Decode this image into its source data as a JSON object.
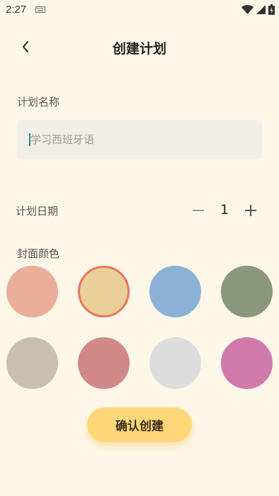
{
  "status_bar": {
    "time": "2:27",
    "icons": [
      "keyboard-icon",
      "wifi-icon",
      "signal-icon",
      "battery-icon"
    ]
  },
  "header": {
    "back_icon": "chevron-left-icon",
    "title": "创建计划"
  },
  "form": {
    "plan_name": {
      "label": "计划名称",
      "value": "",
      "placeholder": "学习西班牙语"
    },
    "plan_days": {
      "label": "计划日期",
      "value": "1",
      "minus_icon": "minus-icon",
      "plus_icon": "plus-icon"
    },
    "cover_color": {
      "label": "封面颜色",
      "selected_index": 1,
      "colors": [
        "#E9AF98",
        "#EACF98",
        "#8AB2D6",
        "#8A977D",
        "#CABFAE",
        "#D08987",
        "#DDDDDD",
        "#D07AAC"
      ]
    }
  },
  "actions": {
    "confirm_label": "确认创建"
  },
  "theme": {
    "background": "#FEF7E7",
    "button": "#FFD778",
    "selected_ring": "#EE7060",
    "cursor": "#1E8F8A"
  }
}
